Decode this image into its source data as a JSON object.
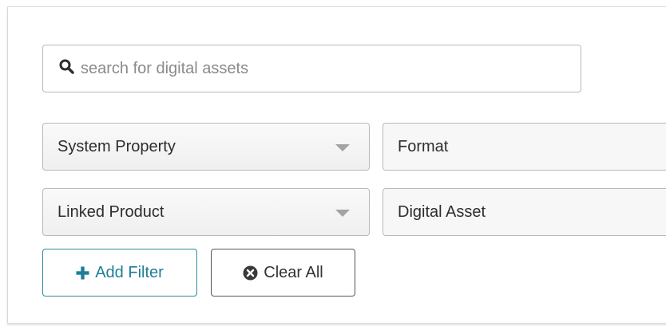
{
  "search": {
    "placeholder": "search for digital assets",
    "value": ""
  },
  "filters": [
    {
      "property": "System Property",
      "value": "Format"
    },
    {
      "property": "Linked Product",
      "value": "Digital Asset"
    }
  ],
  "actions": {
    "add_filter_label": "Add Filter",
    "clear_all_label": "Clear All"
  },
  "icons": {
    "search": "search-icon",
    "add": "plus-icon",
    "clear": "x-circle-icon",
    "dropdown": "caret-down-icon"
  },
  "colors": {
    "accent": "#1e7e98",
    "border": "#b9b9b9",
    "text": "#2d2d2d"
  }
}
